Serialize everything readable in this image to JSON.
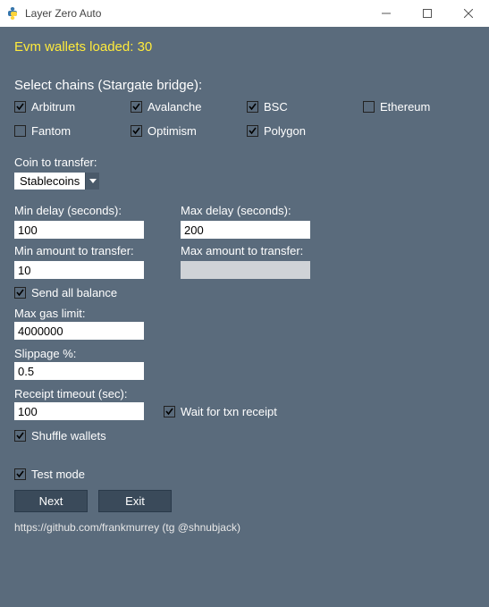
{
  "window": {
    "title": "Layer Zero Auto"
  },
  "status": {
    "loaded": "Evm wallets loaded: 30"
  },
  "chains": {
    "title": "Select chains (Stargate bridge):",
    "items": [
      {
        "label": "Arbitrum",
        "checked": true
      },
      {
        "label": "Avalanche",
        "checked": true
      },
      {
        "label": "BSC",
        "checked": true
      },
      {
        "label": "Ethereum",
        "checked": false
      },
      {
        "label": "Fantom",
        "checked": false
      },
      {
        "label": "Optimism",
        "checked": true
      },
      {
        "label": "Polygon",
        "checked": true
      }
    ]
  },
  "coin": {
    "label": "Coin to transfer:",
    "value": "Stablecoins"
  },
  "min_delay": {
    "label": "Min delay (seconds):",
    "value": "100"
  },
  "max_delay": {
    "label": "Max delay (seconds):",
    "value": "200"
  },
  "min_amount": {
    "label": "Min amount to transfer:",
    "value": "10"
  },
  "max_amount": {
    "label": "Max amount to transfer:",
    "value": ""
  },
  "send_all": {
    "label": "Send all balance",
    "checked": true
  },
  "max_gas": {
    "label": "Max gas limit:",
    "value": "4000000"
  },
  "slippage": {
    "label": "Slippage %:",
    "value": "0.5"
  },
  "receipt_timeout": {
    "label": "Receipt timeout (sec):",
    "value": "100"
  },
  "wait_receipt": {
    "label": "Wait for txn receipt",
    "checked": true
  },
  "shuffle": {
    "label": "Shuffle wallets",
    "checked": true
  },
  "test_mode": {
    "label": "Test mode",
    "checked": true
  },
  "buttons": {
    "next": "Next",
    "exit": "Exit"
  },
  "footer": "https://github.com/frankmurrey (tg @shnubjack)"
}
